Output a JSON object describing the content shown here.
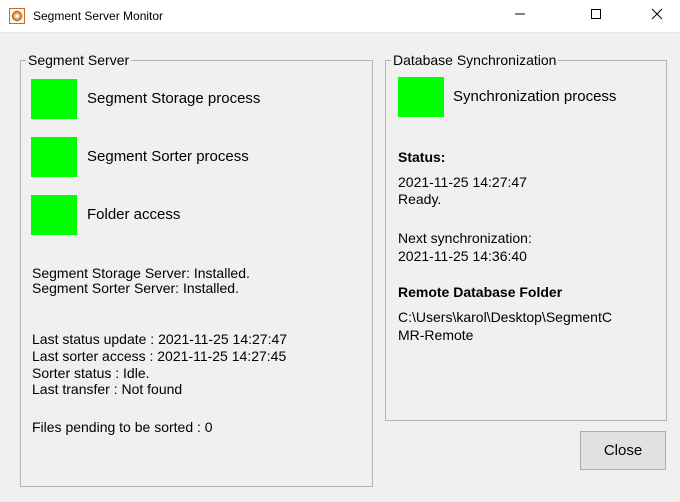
{
  "window": {
    "title": "Segment Server Monitor",
    "minimize_glyph": "—",
    "maximize_glyph": "☐",
    "close_glyph": "✕"
  },
  "segment_server": {
    "title": "Segment Server",
    "indicators": [
      {
        "label": "Segment Storage process",
        "color": "#00ff00"
      },
      {
        "label": "Segment Sorter process",
        "color": "#00ff00"
      },
      {
        "label": "Folder access",
        "color": "#00ff00"
      }
    ],
    "install_lines": [
      "Segment Storage Server: Installed.",
      "Segment Sorter Server: Installed."
    ],
    "status_lines": [
      "Last status update : 2021-11-25 14:27:47",
      "Last sorter access : 2021-11-25 14:27:45",
      "Sorter status : Idle.",
      "Last transfer : Not found"
    ],
    "pending": "Files pending to be sorted : 0"
  },
  "db_sync": {
    "title": "Database Synchronization",
    "indicator": {
      "label": "Synchronization process",
      "color": "#00ff00"
    },
    "status_heading": "Status:",
    "status_time": "2021-11-25 14:27:47",
    "status_text": "Ready.",
    "next_label": "Next synchronization:",
    "next_time": "2021-11-25 14:36:40",
    "remote_heading": "Remote Database Folder",
    "remote_path_line1": "C:\\Users\\karol\\Desktop\\SegmentC",
    "remote_path_line2": "MR-Remote"
  },
  "buttons": {
    "close_label": "Close"
  }
}
